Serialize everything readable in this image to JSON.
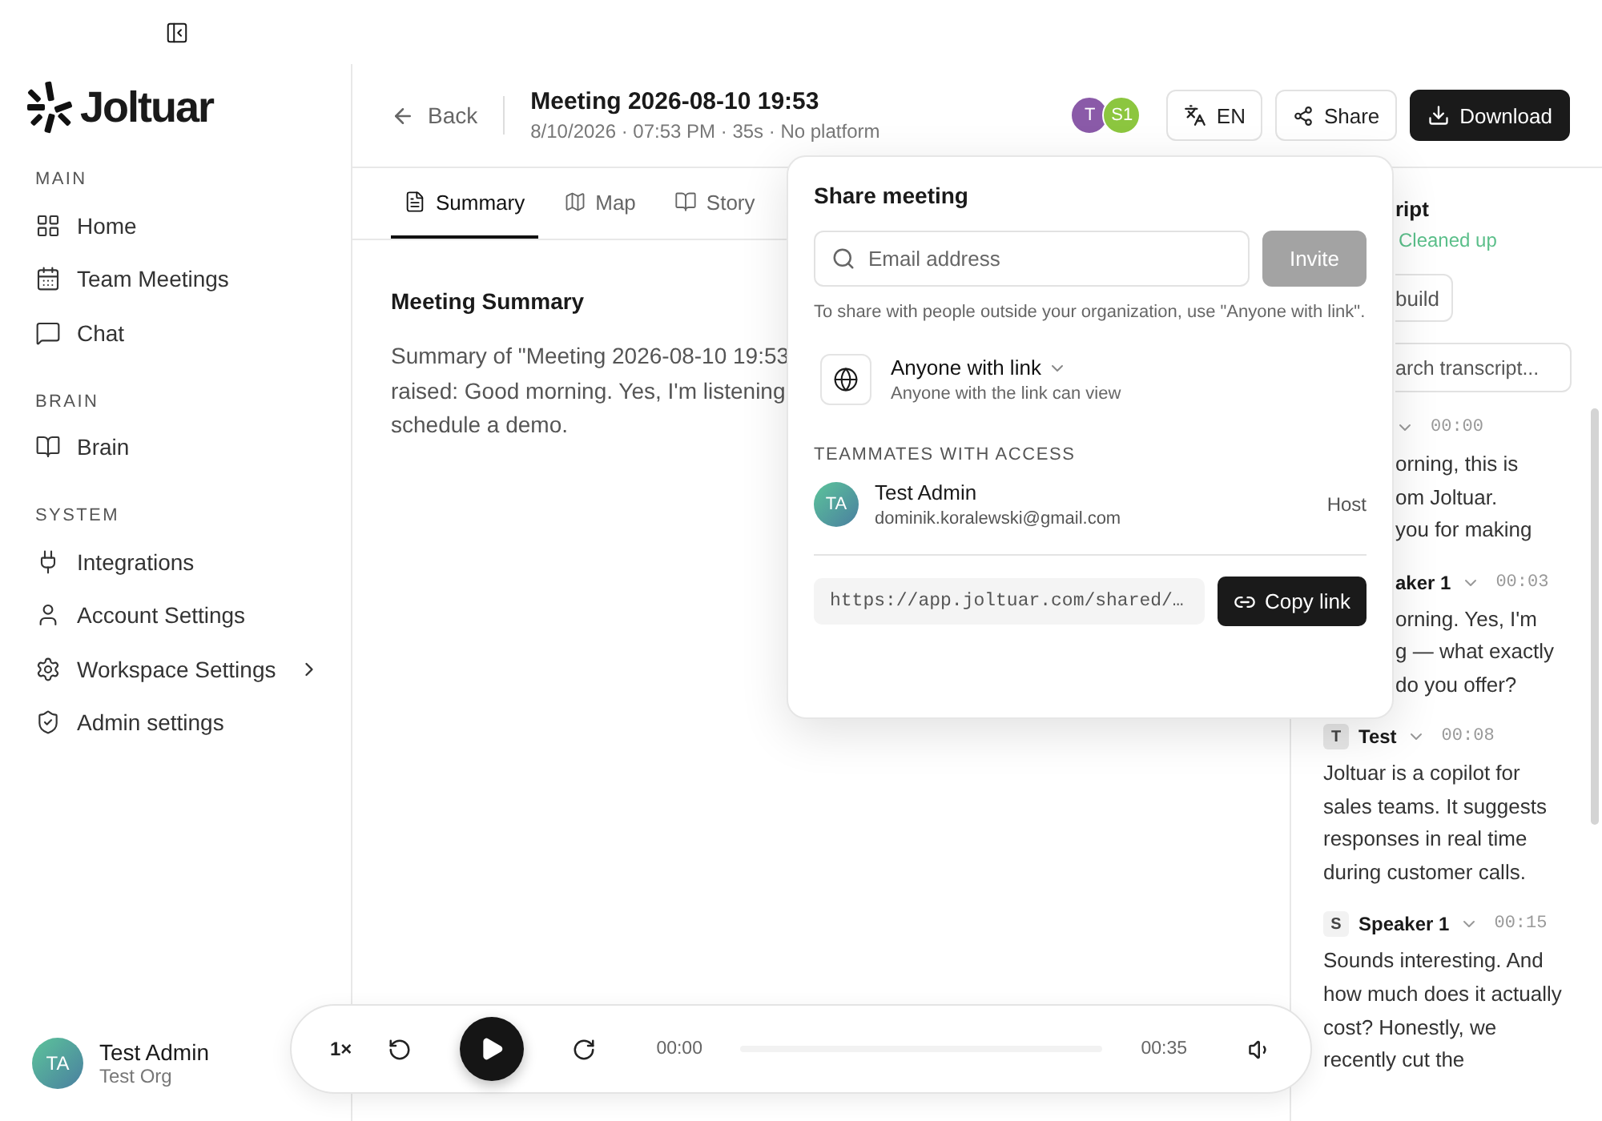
{
  "sidebar": {
    "logo": "Joltuar",
    "sections": [
      {
        "label": "MAIN",
        "items": [
          {
            "label": "Home",
            "selected": false
          },
          {
            "label": "Team Meetings",
            "selected": false
          },
          {
            "label": "Chat",
            "selected": false
          }
        ]
      },
      {
        "label": "BRAIN",
        "items": [
          {
            "label": "Brain",
            "selected": false
          }
        ]
      },
      {
        "label": "SYSTEM",
        "items": [
          {
            "label": "Integrations",
            "selected": false
          },
          {
            "label": "Account Settings",
            "selected": false
          },
          {
            "label": "Workspace Settings",
            "selected": false,
            "submenu": true
          },
          {
            "label": "Admin settings",
            "selected": false
          }
        ]
      }
    ],
    "user": {
      "initials": "TA",
      "name": "Test Admin",
      "org": "Test Org"
    }
  },
  "header": {
    "back": "Back",
    "title": "Meeting 2026-08-10 19:53",
    "subtitle": "8/10/2026 · 07:53 PM · 35s · No platform",
    "participants": [
      {
        "initials": "T",
        "color": "#8a5aa8"
      },
      {
        "initials": "S1",
        "color": "#8cc63f"
      }
    ],
    "language": "EN",
    "share": "Share",
    "download": "Download"
  },
  "tabs": [
    {
      "label": "Summary",
      "selected": true
    },
    {
      "label": "Map",
      "selected": false
    },
    {
      "label": "Story",
      "selected": false
    }
  ],
  "summary": {
    "heading": "Meeting Summary",
    "lines": [
      "Summary of \"Meeting 2026-08-10 19:53",
      "raised: Good morning. Yes, I'm listening",
      "schedule a demo."
    ]
  },
  "transcript": {
    "title": "ript",
    "status": "Cleaned up",
    "rebuild": "build",
    "search_placeholder": "arch transcript...",
    "entries": [
      {
        "kind": "covered",
        "time": "00:00",
        "fragments": [
          "orning, this is",
          "om Joltuar.",
          "you for making"
        ]
      },
      {
        "kind": "covered",
        "speaker": "aker 1",
        "time": "00:03",
        "fragments": [
          "orning. Yes, I'm",
          "g — what exactly"
        ]
      },
      {
        "kind": "tail",
        "text": "do you offer?"
      },
      {
        "kind": "full",
        "avatar": "T",
        "speaker": "Test",
        "time": "00:08",
        "text": "Joltuar is a copilot for sales teams. It suggests responses in real time during customer calls."
      },
      {
        "kind": "full",
        "avatar": "S",
        "speaker": "Speaker 1",
        "time": "00:15",
        "text": "Sounds interesting. And how much does it actually cost? Honestly, we recently cut the"
      }
    ]
  },
  "player": {
    "speed": "1×",
    "current": "00:00",
    "duration": "00:35",
    "level": 0
  },
  "share_popover": {
    "title": "Share meeting",
    "email_placeholder": "Email address",
    "invite": "Invite",
    "invite_disabled": true,
    "hint": "To share with people outside your organization, use \"Anyone with link\".",
    "access": {
      "label": "Anyone with link",
      "description": "Anyone with the link can view"
    },
    "teammates_heading": "TEAMMATES WITH ACCESS",
    "teammates": [
      {
        "initials": "TA",
        "name": "Test Admin",
        "email": "dominik.koralewski@gmail.com",
        "role": "Host"
      }
    ],
    "link": "https://app.joltuar.com/shared/…",
    "copy": "Copy link"
  }
}
